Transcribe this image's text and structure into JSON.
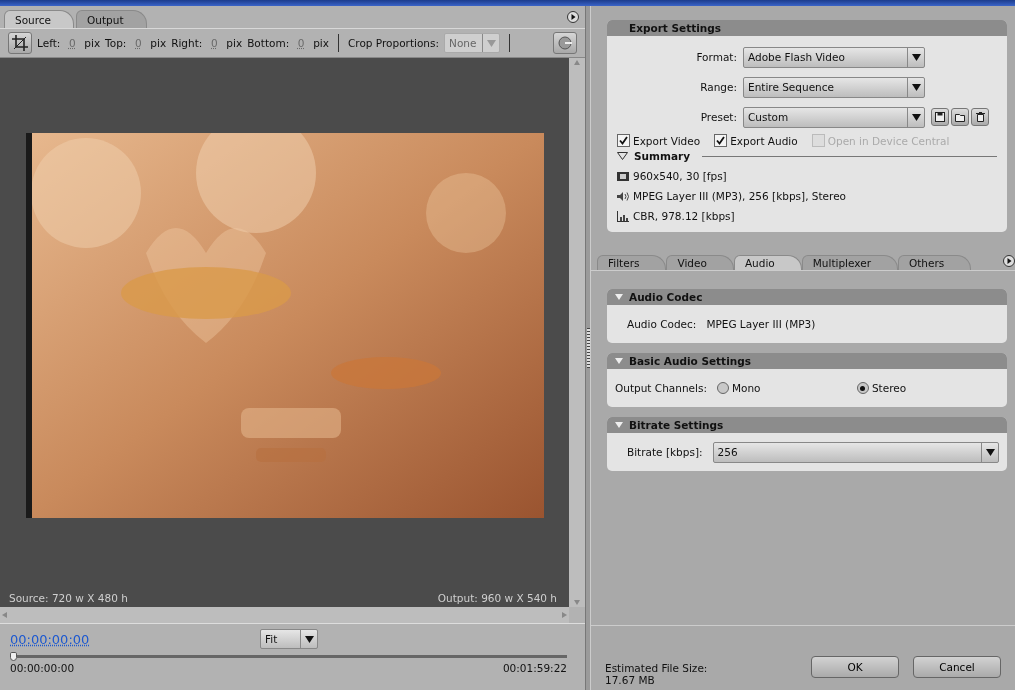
{
  "source_panel": {
    "tabs": [
      {
        "label": "Source",
        "selected": true
      },
      {
        "label": "Output",
        "selected": false
      }
    ],
    "crop_toolbar": {
      "fields": [
        {
          "label": "Left:",
          "value": "0",
          "unit": "pix"
        },
        {
          "label": "Top:",
          "value": "0",
          "unit": "pix"
        },
        {
          "label": "Right:",
          "value": "0",
          "unit": "pix"
        },
        {
          "label": "Bottom:",
          "value": "0",
          "unit": "pix"
        }
      ],
      "crop_proportions": {
        "label": "Crop Proportions:",
        "value": "None",
        "disabled": true
      }
    },
    "preview": {
      "kind": "picture",
      "source_info": "Source: 720 w X 480 h",
      "output_info": "Output: 960 w X 540 h"
    },
    "timecode": "00:00:00:00",
    "zoom": "Fit",
    "timeline": {
      "level": 0,
      "start": "00:00:00:00",
      "end": "00:01:59:22"
    }
  },
  "export_settings": {
    "title": "Export Settings",
    "fields": [
      {
        "label": "Format:",
        "value": "Adobe Flash Video",
        "preset_buttons": false
      },
      {
        "label": "Range:",
        "value": "Entire Sequence",
        "preset_buttons": false
      },
      {
        "label": "Preset:",
        "value": "Custom",
        "preset_buttons": true
      }
    ],
    "checkboxes": [
      {
        "label": "Export Video",
        "checked": true,
        "disabled": false
      },
      {
        "label": "Export Audio",
        "checked": true,
        "disabled": false
      },
      {
        "label": "Open in Device Central",
        "checked": false,
        "disabled": true
      }
    ],
    "summary": {
      "title": "Summary",
      "expanded": true,
      "items": [
        {
          "kind": "video",
          "text": "960x540, 30 [fps]"
        },
        {
          "kind": "audio",
          "text": "MPEG Layer III (MP3), 256 [kbps], Stereo"
        },
        {
          "kind": "bitrate",
          "text": "CBR, 978.12 [kbps]"
        }
      ]
    }
  },
  "tabs": [
    {
      "label": "Filters",
      "selected": false
    },
    {
      "label": "Video",
      "selected": false
    },
    {
      "label": "Audio",
      "selected": true
    },
    {
      "label": "Multiplexer",
      "selected": false
    },
    {
      "label": "Others",
      "selected": false
    }
  ],
  "sections": [
    {
      "title": "Audio Codec",
      "kind": "text",
      "label": "Audio Codec:",
      "value": "MPEG Layer III (MP3)"
    },
    {
      "title": "Basic Audio Settings",
      "kind": "radio",
      "label": "Output Channels:",
      "options": [
        {
          "label": "Mono",
          "selected": false
        },
        {
          "label": "Stereo",
          "selected": true
        }
      ]
    },
    {
      "title": "Bitrate Settings",
      "kind": "dropdown",
      "label": "Bitrate [kbps]:",
      "value": "256"
    }
  ],
  "footer": {
    "estimate_label": "Estimated File Size:",
    "estimate_value": "17.67 MB",
    "buttons": [
      "OK",
      "Cancel"
    ]
  }
}
